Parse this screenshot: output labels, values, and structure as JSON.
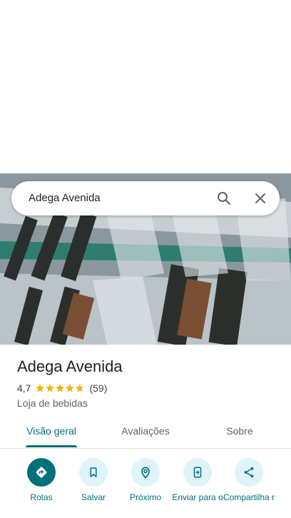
{
  "search": {
    "query": "Adega Avenida"
  },
  "place": {
    "name": "Adega Avenida",
    "rating": "4,7",
    "review_count": "(59)",
    "stars_value": 4.7,
    "category": "Loja de bebidas"
  },
  "tabs": [
    {
      "label": "Visão geral",
      "active": true
    },
    {
      "label": "Avaliações",
      "active": false
    },
    {
      "label": "Sobre",
      "active": false
    }
  ],
  "actions": [
    {
      "label": "Rotas",
      "icon": "directions-icon"
    },
    {
      "label": "Salvar",
      "icon": "bookmark-icon"
    },
    {
      "label": "Próximo",
      "icon": "nearby-icon"
    },
    {
      "label": "Enviar para o",
      "icon": "send-to-phone-icon"
    },
    {
      "label": "Compartilha r",
      "icon": "share-icon"
    }
  ],
  "colors": {
    "accent": "#00707a",
    "action_bg": "#dff3f8",
    "star": "#f4b400"
  }
}
